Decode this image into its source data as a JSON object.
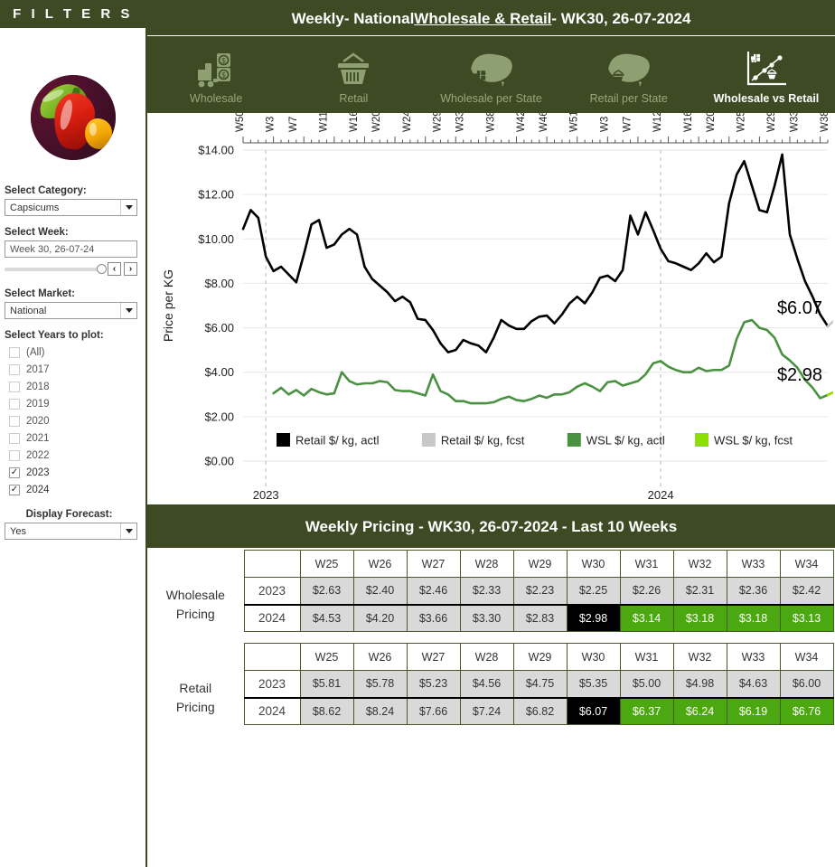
{
  "filters": {
    "title": "F I L T E R S",
    "image_alt": "capsicums-photo",
    "category_label": "Select Category:",
    "category_value": "Capsicums",
    "week_label": "Select Week:",
    "week_value": "Week 30, 26-07-24",
    "step_prev": "‹",
    "step_next": "›",
    "market_label": "Select Market:",
    "market_value": "National",
    "years_label": "Select Years to plot:",
    "years": [
      {
        "label": "(All)",
        "checked": false
      },
      {
        "label": "2017",
        "checked": false
      },
      {
        "label": "2018",
        "checked": false
      },
      {
        "label": "2019",
        "checked": false
      },
      {
        "label": "2020",
        "checked": false
      },
      {
        "label": "2021",
        "checked": false
      },
      {
        "label": "2022",
        "checked": false
      },
      {
        "label": "2023",
        "checked": true
      },
      {
        "label": "2024",
        "checked": true
      }
    ],
    "forecast_label": "Display Forecast:",
    "forecast_value": "Yes",
    "check_glyph": "✓"
  },
  "header": {
    "title_pre": "Weekly- National ",
    "title_underline": "Wholesale & Retail",
    "title_post": " - WK30, 26-07-2024"
  },
  "tabs": [
    {
      "label": "Wholesale",
      "icon": "wholesale-truck-icon",
      "active": false
    },
    {
      "label": "Retail",
      "icon": "retail-basket-icon",
      "active": false
    },
    {
      "label": "Wholesale per State",
      "icon": "wholesale-map-icon",
      "active": false
    },
    {
      "label": "Retail per State",
      "icon": "retail-map-icon",
      "active": false
    },
    {
      "label": "Wholesale vs Retail",
      "icon": "scatter-compare-icon",
      "active": true
    }
  ],
  "chart_data": {
    "type": "line",
    "title": "",
    "ylabel": "Price per KG",
    "xlabel": "",
    "ylim": [
      0,
      14
    ],
    "ytick_labels": [
      "$14.00",
      "$12.00",
      "$10.00",
      "$8.00",
      "$6.00",
      "$4.00",
      "$2.00",
      "$0.00"
    ],
    "ytick_values": [
      14,
      12,
      10,
      8,
      6,
      4,
      2,
      0
    ],
    "xtick_labels": [
      "W50",
      "W3",
      "W7",
      "W11",
      "W16",
      "W20",
      "W24",
      "W29",
      "W33",
      "W38",
      "W42",
      "W46",
      "W51",
      "W3",
      "W7",
      "W12",
      "W16",
      "W20",
      "W25",
      "W29",
      "W33",
      "W38"
    ],
    "year_markers": [
      "2023",
      "2024"
    ],
    "grid": true,
    "legend_position": "inside-bottom",
    "legend": [
      {
        "name": "Retail $/ kg, actl",
        "color": "#000000"
      },
      {
        "name": "Retail $/ kg, fcst",
        "color": "#c8c8c8"
      },
      {
        "name": "WSL $/ kg, actl",
        "color": "#4b9142"
      },
      {
        "name": "WSL $/ kg, fcst",
        "color": "#8ede00"
      }
    ],
    "annotations": [
      {
        "text": "$6.07",
        "series": "Retail $/ kg, actl"
      },
      {
        "text": "$2.98",
        "series": "WSL $/ kg, actl"
      }
    ],
    "series": [
      {
        "name": "Retail $/ kg, actl",
        "color": "#000000",
        "values": [
          10.45,
          11.3,
          10.95,
          9.2,
          8.55,
          8.75,
          8.4,
          8.05,
          9.3,
          10.65,
          10.85,
          9.6,
          9.75,
          10.2,
          10.45,
          10.2,
          8.75,
          8.2,
          7.9,
          7.6,
          7.2,
          7.4,
          7.15,
          6.4,
          6.35,
          5.9,
          5.3,
          4.9,
          5.0,
          5.45,
          5.3,
          5.2,
          4.9,
          5.55,
          6.35,
          6.1,
          5.95,
          5.95,
          6.3,
          6.5,
          6.55,
          6.2,
          6.6,
          7.1,
          7.4,
          7.1,
          7.6,
          8.25,
          8.35,
          8.1,
          8.6,
          11.05,
          10.2,
          11.2,
          10.4,
          9.55,
          9.0,
          8.9,
          8.75,
          8.6,
          8.9,
          9.35,
          8.95,
          9.2,
          11.6,
          12.9,
          13.5,
          12.4,
          11.3,
          11.2,
          12.4,
          13.8,
          10.2,
          9.1,
          8.1,
          7.4,
          6.6,
          6.07
        ]
      },
      {
        "name": "Retail $/ kg, fcst",
        "color": "#c8c8c8",
        "values": [
          6.07,
          6.37,
          6.24,
          6.19,
          6.76
        ]
      },
      {
        "name": "WSL $/ kg, actl",
        "color": "#4b9142",
        "values": [
          3.05,
          3.3,
          3.0,
          3.2,
          2.95,
          3.25,
          3.1,
          3.0,
          3.05,
          4.0,
          3.6,
          3.45,
          3.5,
          3.5,
          3.6,
          3.55,
          3.2,
          3.15,
          3.15,
          3.05,
          2.95,
          3.9,
          3.15,
          3.0,
          2.7,
          2.7,
          2.6,
          2.6,
          2.6,
          2.65,
          2.8,
          2.9,
          2.75,
          2.7,
          2.8,
          2.95,
          2.85,
          3.0,
          3.0,
          3.1,
          3.35,
          3.5,
          3.35,
          3.15,
          3.55,
          3.6,
          3.4,
          3.5,
          3.6,
          3.9,
          4.4,
          4.5,
          4.25,
          4.1,
          4.0,
          4.0,
          4.2,
          4.05,
          4.1,
          4.1,
          4.3,
          5.5,
          6.25,
          6.35,
          6.0,
          5.9,
          5.55,
          4.8,
          4.53,
          4.2,
          3.66,
          3.3,
          2.83,
          2.98
        ]
      },
      {
        "name": "WSL $/ kg, fcst",
        "color": "#8ede00",
        "values": [
          2.98,
          3.14,
          3.18,
          3.18,
          3.13
        ]
      }
    ]
  },
  "table_section": {
    "title": "Weekly Pricing - WK30, 26-07-2024 - Last 10 Weeks",
    "week_headers": [
      "W25",
      "W26",
      "W27",
      "W28",
      "W29",
      "W30",
      "W31",
      "W32",
      "W33",
      "W34"
    ],
    "tables": [
      {
        "row_label": "Wholesale\nPricing",
        "row_label_line1": "Wholesale",
        "row_label_line2": "Pricing",
        "rows": [
          {
            "year": "2023",
            "values": [
              "$2.63",
              "$2.40",
              "$2.46",
              "$2.33",
              "$2.23",
              "$2.25",
              "$2.26",
              "$2.31",
              "$2.36",
              "$2.42"
            ],
            "styles": [
              "grey",
              "grey",
              "grey",
              "grey",
              "grey",
              "grey",
              "grey",
              "grey",
              "grey",
              "grey"
            ]
          },
          {
            "year": "2024",
            "values": [
              "$4.53",
              "$4.20",
              "$3.66",
              "$3.30",
              "$2.83",
              "$2.98",
              "$3.14",
              "$3.18",
              "$3.18",
              "$3.13"
            ],
            "styles": [
              "grey",
              "grey",
              "grey",
              "grey",
              "grey",
              "black",
              "green",
              "green",
              "green",
              "green"
            ]
          }
        ]
      },
      {
        "row_label": "Retail\nPricing",
        "row_label_line1": "Retail",
        "row_label_line2": "Pricing",
        "rows": [
          {
            "year": "2023",
            "values": [
              "$5.81",
              "$5.78",
              "$5.23",
              "$4.56",
              "$4.75",
              "$5.35",
              "$5.00",
              "$4.98",
              "$4.63",
              "$6.00"
            ],
            "styles": [
              "grey",
              "grey",
              "grey",
              "grey",
              "grey",
              "grey",
              "grey",
              "grey",
              "grey",
              "grey"
            ]
          },
          {
            "year": "2024",
            "values": [
              "$8.62",
              "$8.24",
              "$7.66",
              "$7.24",
              "$6.82",
              "$6.07",
              "$6.37",
              "$6.24",
              "$6.19",
              "$6.76"
            ],
            "styles": [
              "grey",
              "grey",
              "grey",
              "grey",
              "grey",
              "black",
              "green",
              "green",
              "green",
              "green"
            ]
          }
        ]
      }
    ]
  },
  "colors": {
    "brand_dark_green": "#3d4a23",
    "accent_green": "#4ca810",
    "series_green": "#4b9142",
    "forecast_green": "#8ede00",
    "grey_cell": "#d9d9d9",
    "black_cell": "#000000"
  }
}
